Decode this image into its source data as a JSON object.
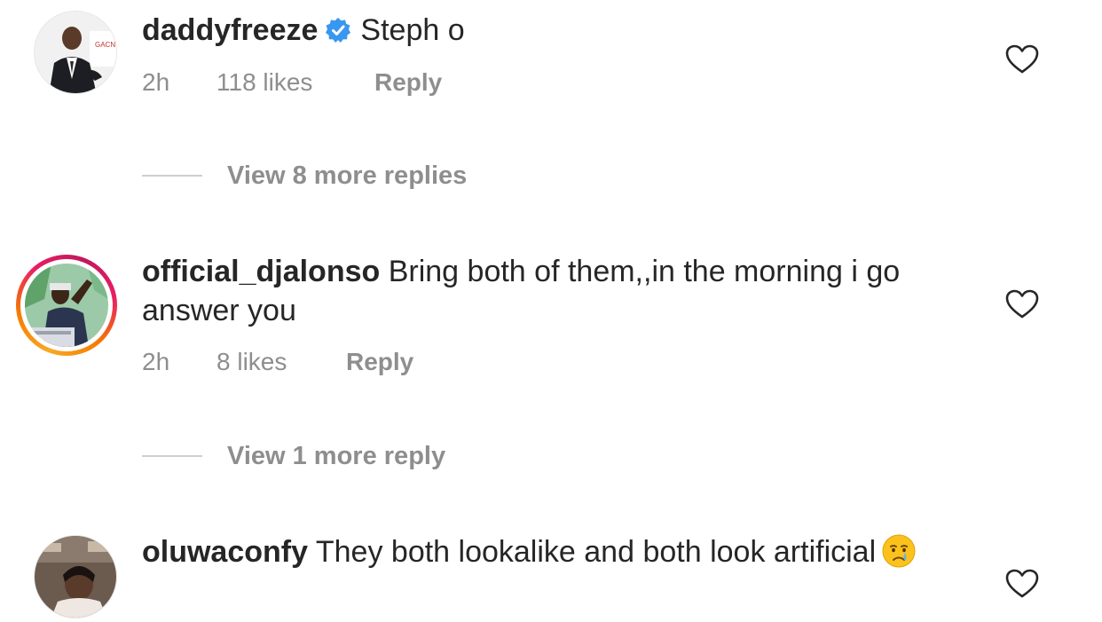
{
  "comments": [
    {
      "username": "daddyfreeze",
      "verified": true,
      "text": "Steph o",
      "time": "2h",
      "likes": "118 likes",
      "reply": "Reply",
      "avatar_icon": "avatar-photo",
      "has_story_ring": false,
      "view_replies": "View 8 more replies"
    },
    {
      "username": "official_djalonso",
      "verified": false,
      "text": "Bring both of them,,in the morning i go answer you",
      "time": "2h",
      "likes": "8 likes",
      "reply": "Reply",
      "avatar_icon": "avatar-photo",
      "has_story_ring": true,
      "view_replies": "View 1 more reply"
    },
    {
      "username": "oluwaconfy",
      "verified": false,
      "text": "They both lookalike and both look artificial",
      "emoji": "crying-face-emoji",
      "avatar_icon": "avatar-photo",
      "has_story_ring": false
    }
  ],
  "colors": {
    "meta_gray": "#8e8e8e",
    "verified_blue": "#3897f0",
    "ring_gradient_start": "#f9a825",
    "ring_gradient_end": "#e91e63"
  }
}
